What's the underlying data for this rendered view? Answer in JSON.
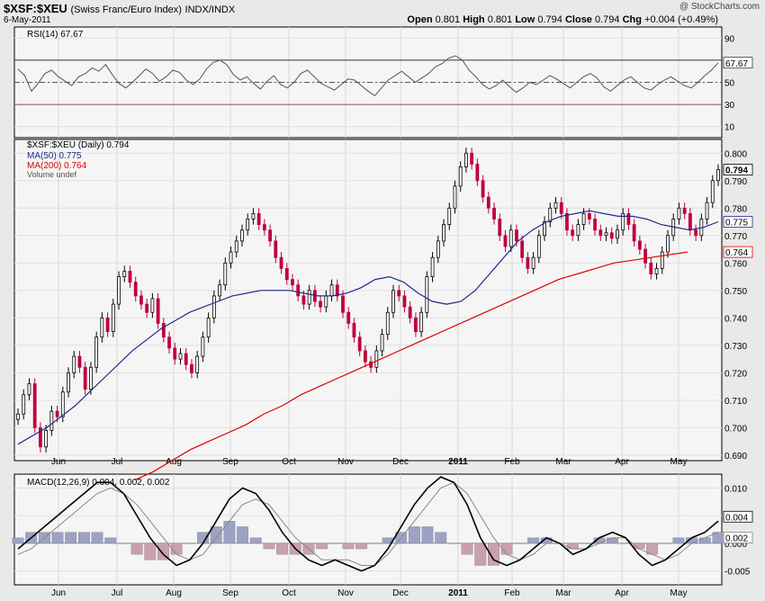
{
  "header": {
    "symbol": "$XSF:$XEU",
    "name": "(Swiss Franc/Euro Index)",
    "exchange": "INDX/INDX",
    "date": "6-May-2011",
    "watermark": "@ StockCharts.com",
    "open_label": "Open",
    "open": "0.801",
    "high_label": "High",
    "high": "0.801",
    "low_label": "Low",
    "low": "0.794",
    "close_label": "Close",
    "close": "0.794",
    "chg_label": "Chg",
    "chg": "+0.004 (+0.49%)"
  },
  "colors": {
    "price_up": "#000000",
    "price_down": "#c0003c",
    "ma50": "#1f2a8c",
    "ma200": "#e00000",
    "rsi": "#555555",
    "macd": "#000000",
    "signal": "#888888",
    "hist": "#b0a0b8"
  },
  "x_months": [
    "Jun",
    "Jul",
    "Aug",
    "Sep",
    "Oct",
    "Nov",
    "Dec",
    "2011",
    "Feb",
    "Mar",
    "Apr",
    "May"
  ],
  "chart_data": [
    {
      "type": "line",
      "title": "RSI(14) 67.67",
      "y_ticks": [
        10,
        30,
        50,
        70,
        90
      ],
      "ylim": [
        0,
        100
      ],
      "reference_lines": [
        30,
        50,
        70
      ],
      "last_value_label": "67.67",
      "series": [
        {
          "name": "RSI(14)",
          "values": [
            62,
            56,
            42,
            49,
            58,
            61,
            55,
            51,
            47,
            55,
            58,
            63,
            60,
            66,
            57,
            49,
            45,
            50,
            56,
            62,
            58,
            51,
            55,
            61,
            59,
            52,
            48,
            53,
            62,
            68,
            70,
            66,
            57,
            52,
            55,
            49,
            44,
            51,
            56,
            48,
            45,
            50,
            58,
            61,
            55,
            49,
            46,
            43,
            48,
            53,
            52,
            47,
            42,
            38,
            45,
            52,
            56,
            60,
            55,
            50,
            54,
            58,
            64,
            67,
            72,
            74,
            70,
            61,
            55,
            48,
            44,
            47,
            52,
            46,
            41,
            45,
            50,
            48,
            52,
            56,
            53,
            49,
            45,
            50,
            55,
            58,
            54,
            46,
            42,
            47,
            52,
            55,
            50,
            45,
            43,
            48,
            52,
            55,
            51,
            47,
            45,
            50,
            56,
            61,
            67.67
          ]
        }
      ]
    },
    {
      "type": "candlestick",
      "title": "$XSF:$XEU (Daily) 0.794",
      "y_ticks": [
        0.69,
        0.7,
        0.71,
        0.72,
        0.73,
        0.74,
        0.75,
        0.76,
        0.77,
        0.78,
        0.79,
        0.8
      ],
      "ylim": [
        0.688,
        0.805
      ],
      "legend": [
        "$XSF:$XEU (Daily) 0.794",
        "MA(50) 0.775",
        "MA(200) 0.764",
        "Volume undef"
      ],
      "last_labels": {
        "close": "0.794",
        "ma50": "0.775",
        "ma200": "0.764"
      },
      "series": [
        {
          "name": "$XSF:$XEU",
          "close": [
            0.705,
            0.712,
            0.716,
            0.7,
            0.693,
            0.699,
            0.706,
            0.704,
            0.713,
            0.72,
            0.726,
            0.722,
            0.714,
            0.722,
            0.733,
            0.74,
            0.735,
            0.745,
            0.755,
            0.757,
            0.753,
            0.748,
            0.745,
            0.742,
            0.747,
            0.738,
            0.733,
            0.729,
            0.725,
            0.727,
            0.723,
            0.72,
            0.726,
            0.733,
            0.74,
            0.748,
            0.752,
            0.76,
            0.764,
            0.768,
            0.772,
            0.776,
            0.778,
            0.774,
            0.772,
            0.768,
            0.762,
            0.758,
            0.754,
            0.752,
            0.748,
            0.745,
            0.75,
            0.746,
            0.744,
            0.748,
            0.752,
            0.748,
            0.742,
            0.738,
            0.733,
            0.728,
            0.724,
            0.722,
            0.728,
            0.734,
            0.742,
            0.75,
            0.748,
            0.744,
            0.74,
            0.735,
            0.742,
            0.755,
            0.762,
            0.768,
            0.774,
            0.78,
            0.788,
            0.795,
            0.8,
            0.796,
            0.79,
            0.784,
            0.78,
            0.776,
            0.77,
            0.766,
            0.772,
            0.768,
            0.762,
            0.758,
            0.762,
            0.77,
            0.775,
            0.78,
            0.782,
            0.778,
            0.772,
            0.77,
            0.774,
            0.778,
            0.776,
            0.772,
            0.77,
            0.771,
            0.769,
            0.772,
            0.778,
            0.774,
            0.768,
            0.765,
            0.76,
            0.756,
            0.758,
            0.764,
            0.77,
            0.776,
            0.78,
            0.778,
            0.772,
            0.77,
            0.776,
            0.782,
            0.79,
            0.794
          ]
        },
        {
          "name": "MA(50)",
          "values": [
            0.694,
            0.697,
            0.7,
            0.704,
            0.708,
            0.713,
            0.718,
            0.723,
            0.728,
            0.732,
            0.736,
            0.739,
            0.742,
            0.744,
            0.746,
            0.748,
            0.749,
            0.75,
            0.75,
            0.75,
            0.749,
            0.748,
            0.748,
            0.749,
            0.751,
            0.754,
            0.755,
            0.753,
            0.749,
            0.746,
            0.745,
            0.746,
            0.75,
            0.756,
            0.762,
            0.768,
            0.772,
            0.775,
            0.777,
            0.778,
            0.779,
            0.778,
            0.777,
            0.777,
            0.776,
            0.774,
            0.773,
            0.772,
            0.773,
            0.775
          ]
        },
        {
          "name": "MA(200)",
          "values": [
            0.681,
            0.684,
            0.688,
            0.692,
            0.695,
            0.698,
            0.701,
            0.705,
            0.708,
            0.712,
            0.715,
            0.718,
            0.721,
            0.724,
            0.727,
            0.73,
            0.733,
            0.736,
            0.739,
            0.742,
            0.745,
            0.748,
            0.751,
            0.754,
            0.756,
            0.758,
            0.76,
            0.761,
            0.762,
            0.763,
            0.764
          ]
        }
      ]
    },
    {
      "type": "line",
      "title": "MACD(12,26,9) 0.004, 0.002, 0.002",
      "y_ticks": [
        -0.005,
        0.0,
        0.005,
        0.01
      ],
      "ylim": [
        -0.0075,
        0.0125
      ],
      "last_labels": {
        "macd": "0.004",
        "signal": "0.002"
      },
      "series": [
        {
          "name": "MACD(12,26,9)",
          "values": [
            -0.001,
            0.001,
            0.003,
            0.005,
            0.007,
            0.009,
            0.011,
            0.011,
            0.009,
            0.005,
            0.001,
            -0.002,
            -0.004,
            -0.003,
            0.0,
            0.004,
            0.008,
            0.01,
            0.009,
            0.006,
            0.002,
            -0.001,
            -0.003,
            -0.004,
            -0.003,
            -0.004,
            -0.005,
            -0.004,
            -0.001,
            0.003,
            0.007,
            0.01,
            0.012,
            0.011,
            0.007,
            0.001,
            -0.003,
            -0.004,
            -0.003,
            -0.001,
            0.001,
            0.0,
            -0.002,
            -0.001,
            0.001,
            0.002,
            0.001,
            -0.002,
            -0.004,
            -0.003,
            -0.001,
            0.001,
            0.002,
            0.004
          ]
        },
        {
          "name": "signal",
          "values": [
            -0.002,
            -0.001,
            0.001,
            0.003,
            0.005,
            0.007,
            0.009,
            0.01,
            0.009,
            0.007,
            0.004,
            0.001,
            -0.002,
            -0.003,
            -0.002,
            0.001,
            0.004,
            0.007,
            0.008,
            0.007,
            0.004,
            0.001,
            -0.001,
            -0.003,
            -0.003,
            -0.003,
            -0.004,
            -0.004,
            -0.002,
            0.001,
            0.004,
            0.007,
            0.01,
            0.011,
            0.009,
            0.005,
            0.001,
            -0.002,
            -0.003,
            -0.002,
            0.0,
            0.0,
            -0.001,
            -0.001,
            0.0,
            0.001,
            0.001,
            -0.001,
            -0.002,
            -0.003,
            -0.002,
            0.0,
            0.001,
            0.002
          ]
        },
        {
          "name": "histogram",
          "values": [
            0.001,
            0.002,
            0.002,
            0.002,
            0.002,
            0.002,
            0.002,
            0.001,
            0.0,
            -0.002,
            -0.003,
            -0.003,
            -0.002,
            0.0,
            0.002,
            0.003,
            0.004,
            0.003,
            0.001,
            -0.001,
            -0.002,
            -0.002,
            -0.002,
            -0.001,
            0.0,
            -0.001,
            -0.001,
            0.0,
            0.001,
            0.002,
            0.003,
            0.003,
            0.002,
            0.0,
            -0.002,
            -0.004,
            -0.004,
            -0.002,
            0.0,
            0.001,
            0.001,
            0.0,
            -0.001,
            0.0,
            0.001,
            0.001,
            0.0,
            -0.001,
            -0.002,
            0.0,
            0.001,
            0.001,
            0.001,
            0.002
          ]
        }
      ]
    }
  ]
}
